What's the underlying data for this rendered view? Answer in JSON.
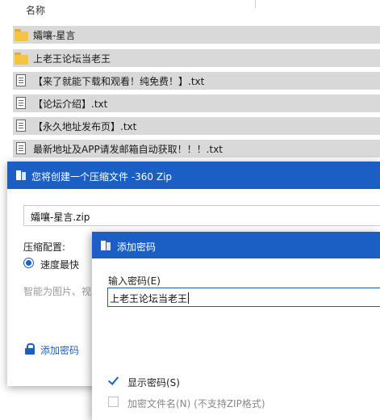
{
  "file_list": {
    "column_name": "名称",
    "rows": [
      {
        "name": "孀嚷-星言",
        "icon": "folder-icon"
      },
      {
        "name": "上老王论坛当老王",
        "icon": "folder-icon"
      },
      {
        "name": "【来了就能下载和观看！纯免费！】.txt",
        "icon": "text-file-icon"
      },
      {
        "name": "【论坛介绍】.txt",
        "icon": "text-file-icon"
      },
      {
        "name": "【永久地址发布页】.txt",
        "icon": "text-file-icon"
      },
      {
        "name": "最新地址及APP请发邮箱自动获取！！！.txt",
        "icon": "text-file-icon"
      }
    ]
  },
  "zip_dialog": {
    "title": "您将创建一个压缩文件 -360 Zip",
    "filename": "孀嚷-星言.zip",
    "config_label": "压缩配置:",
    "speed_option": "速度最快",
    "smart_text": "智能为图片、视",
    "add_password_link": "添加密码",
    "accent_color": "#1b5fc4"
  },
  "password_dialog": {
    "title": "添加密码",
    "input_label": "输入密码(E)",
    "password_value": "上老王论坛当老王",
    "show_password": {
      "label": "显示密码(S)",
      "checked": true
    },
    "encrypt_names": {
      "label": "加密文件名(N) (不支持ZIP格式)",
      "checked": false
    }
  }
}
